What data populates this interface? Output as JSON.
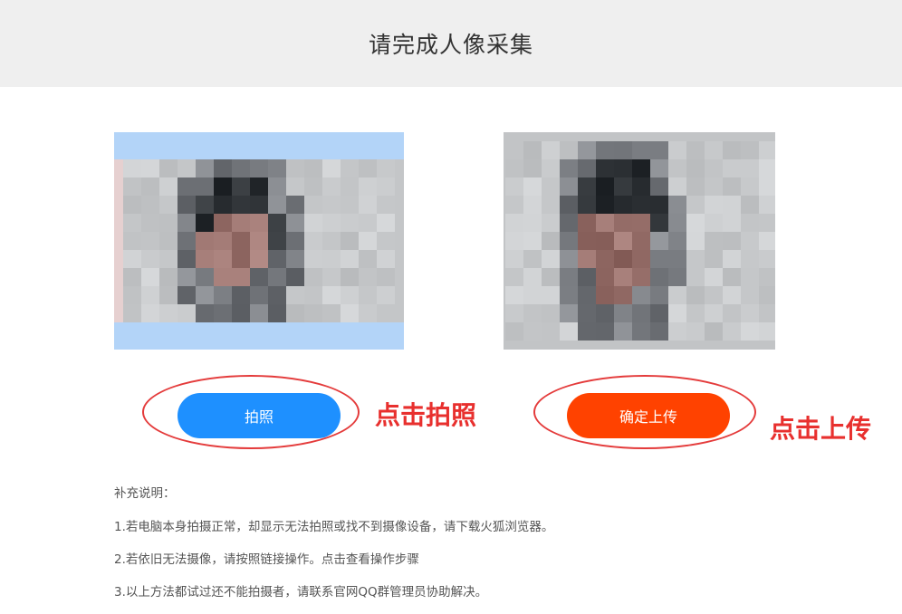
{
  "header": {
    "title": "请完成人像采集"
  },
  "camera_preview": {
    "alt": "camera-preview"
  },
  "captured_photo": {
    "alt": "captured-photo"
  },
  "buttons": {
    "capture_label": "拍照",
    "upload_label": "确定上传"
  },
  "annotations": {
    "capture_hint": "点击拍照",
    "upload_hint": "点击上传"
  },
  "notes": {
    "title": "补充说明：",
    "line1": "1.若电脑本身拍摄正常，却显示无法拍照或找不到摄像设备，请下载火狐浏览器。",
    "line2_prefix": "2.若依旧无法摄像，请按照链接操作。",
    "line2_link": "点击查看操作步骤",
    "line3": "3.以上方法都试过还不能拍摄者，请联系官网QQ群管理员协助解决。"
  },
  "colors": {
    "capture_button": "#1e90ff",
    "upload_button": "#ff4200",
    "annotation": "#e8302e",
    "header_bg": "#efefef"
  }
}
